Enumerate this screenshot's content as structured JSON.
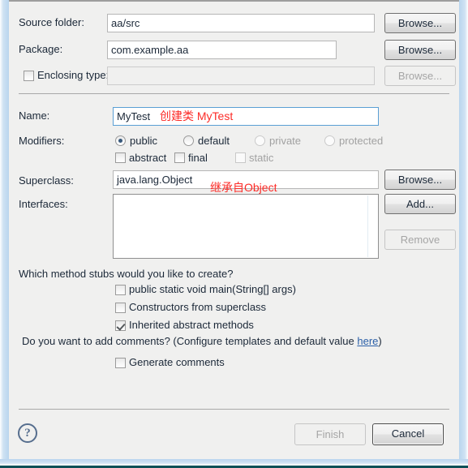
{
  "dialog": {
    "fields": {
      "source_folder_label": "Source folder:",
      "source_folder_value": "aa/src",
      "package_label": "Package:",
      "package_value": "com.example.aa",
      "enclosing_type_label": "Enclosing type:",
      "enclosing_type_value": "",
      "name_label": "Name:",
      "name_value": "MyTest",
      "modifiers_label": "Modifiers:",
      "superclass_label": "Superclass:",
      "superclass_value": "java.lang.Object",
      "interfaces_label": "Interfaces:"
    },
    "modifiers": {
      "radios": [
        {
          "label": "public",
          "selected": true,
          "enabled": true
        },
        {
          "label": "default",
          "selected": false,
          "enabled": true
        },
        {
          "label": "private",
          "selected": false,
          "enabled": false
        },
        {
          "label": "protected",
          "selected": false,
          "enabled": false
        }
      ],
      "checkboxes": [
        {
          "label": "abstract",
          "checked": false,
          "enabled": true
        },
        {
          "label": "final",
          "checked": false,
          "enabled": true
        },
        {
          "label": "static",
          "checked": false,
          "enabled": false
        }
      ]
    },
    "buttons": {
      "browse_source": "Browse...",
      "browse_package": "Browse...",
      "browse_enclosing": "Browse...",
      "browse_superclass": "Browse...",
      "add": "Add...",
      "remove": "Remove",
      "finish": "Finish",
      "cancel": "Cancel"
    },
    "stubs": {
      "question": "Which method stubs would you like to create?",
      "items": [
        {
          "label": "public static void main(String[] args)",
          "checked": false
        },
        {
          "label": "Constructors from superclass",
          "checked": false
        },
        {
          "label": "Inherited abstract methods",
          "checked": true
        }
      ]
    },
    "comments": {
      "question_prefix": "Do you want to add comments? (Configure templates and default value ",
      "link": "here",
      "question_suffix": ")",
      "generate_label": "Generate comments",
      "generate_checked": false
    },
    "help_icon": "?",
    "annotations": [
      {
        "text": "创建类 MyTest"
      },
      {
        "text": "继承自Object"
      }
    ],
    "colors": {
      "annotation": "#fc2b27",
      "link": "#2b5fa8",
      "frame": "#b9d5ee",
      "background": "#f0f0ef",
      "focus_border": "#5a9fd4"
    }
  }
}
